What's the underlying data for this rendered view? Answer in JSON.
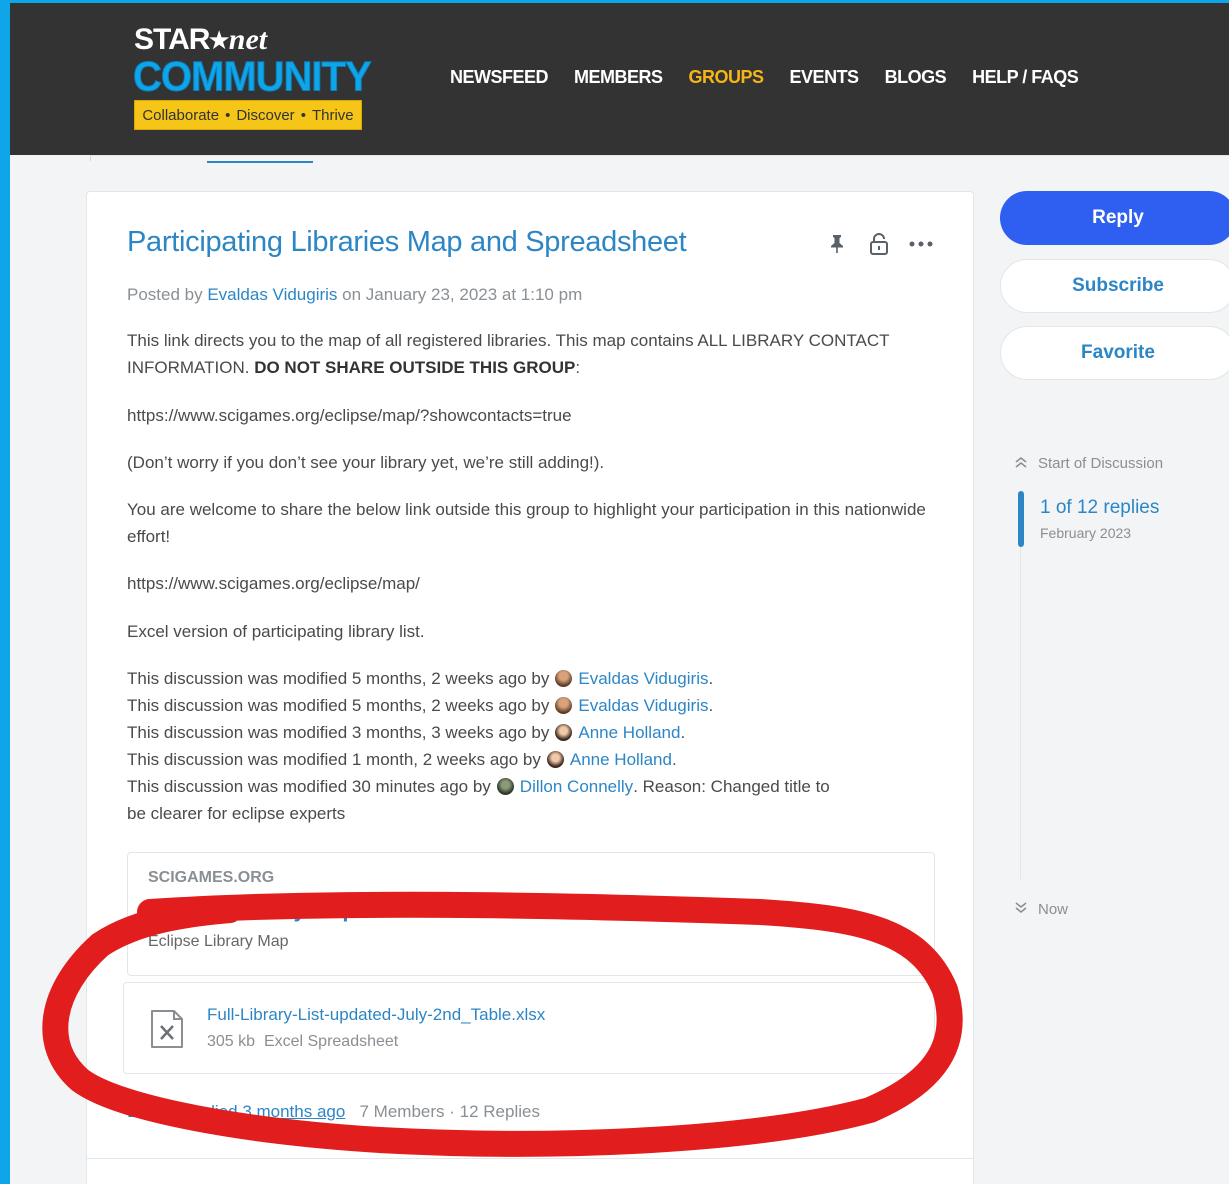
{
  "logo": {
    "star": "STAR",
    "net": "net",
    "community": "COMMUNITY",
    "tagline": [
      "Collaborate",
      "Discover",
      "Thrive"
    ],
    "separator": "•"
  },
  "nav": {
    "items": [
      {
        "label": "NEWSFEED",
        "active": false
      },
      {
        "label": "MEMBERS",
        "active": false
      },
      {
        "label": "GROUPS",
        "active": true
      },
      {
        "label": "EVENTS",
        "active": false
      },
      {
        "label": "BLOGS",
        "active": false
      },
      {
        "label": "HELP / FAQS",
        "active": false
      }
    ]
  },
  "discussion": {
    "title": "Participating Libraries Map and Spreadsheet",
    "meta": {
      "prefix": "Posted by",
      "author": "Evaldas Vidugiris",
      "suffix": "on January 23, 2023 at 1:10 pm"
    },
    "para1_text": "This link directs you to the map of all registered libraries. This map contains ALL LIBRARY CONTACT INFORMATION.",
    "para1_bold": "DO NOT SHARE OUTSIDE THIS GROUP",
    "para1_end": ":",
    "link1": "https://www.scigames.org/eclipse/map/?showcontacts=true",
    "para2": "(Don’t worry if you don’t see your library yet, we’re still adding!).",
    "para3": "You are welcome to share the below link outside this group to highlight your participation in this nationwide effort!",
    "link2": "https://www.scigames.org/eclipse/map/",
    "para4": "Excel version of participating library list.",
    "modifications": [
      {
        "prefix": "This discussion was modified 5 months, 2 weeks ago by",
        "user": "Evaldas Vidugiris",
        "suffix": "."
      },
      {
        "prefix": "This discussion was modified 5 months, 2 weeks ago by",
        "user": "Evaldas Vidugiris",
        "suffix": "."
      },
      {
        "prefix": "This discussion was modified 3 months, 3 weeks ago by",
        "user": "Anne Holland",
        "suffix": "."
      },
      {
        "prefix": "This discussion was modified 1 month, 2 weeks ago by",
        "user": "Anne Holland",
        "suffix": "."
      },
      {
        "prefix": "This discussion was modified 30 minutes ago by",
        "user": "Dillon Connelly",
        "suffix": ". Reason: Changed title to"
      }
    ],
    "mod_last_wrap": "be clearer for eclipse experts",
    "embed": {
      "site": "SCIGAMES.ORG",
      "title": "Eclipse Library Map",
      "description": "Eclipse Library Map"
    },
    "attachment": {
      "icon": "excel-file-icon",
      "name": "Full-Library-List-updated-July-2nd_Table.xlsx",
      "size": "305 kb",
      "type": "Excel Spreadsheet"
    },
    "footer": {
      "last_replied_prefix": "Last by replied",
      "last_replied_time": "3 months ago",
      "stats": "7 Members · 12 Replies"
    }
  },
  "sidebar": {
    "reply_label": "Reply",
    "subscribe_label": "Subscribe",
    "favorite_label": "Favorite",
    "timeline": {
      "start_label": "Start of Discussion",
      "count_label": "1 of 12 replies",
      "date_label": "February 2023",
      "end_label": "Now"
    }
  },
  "colors": {
    "link": "#2c86c6",
    "header_bg": "#333333",
    "nav_active": "#f5b517",
    "primary_button": "#2f5ff0",
    "annotation": "#e11d1d",
    "outer_border": "#0ea5e9"
  }
}
